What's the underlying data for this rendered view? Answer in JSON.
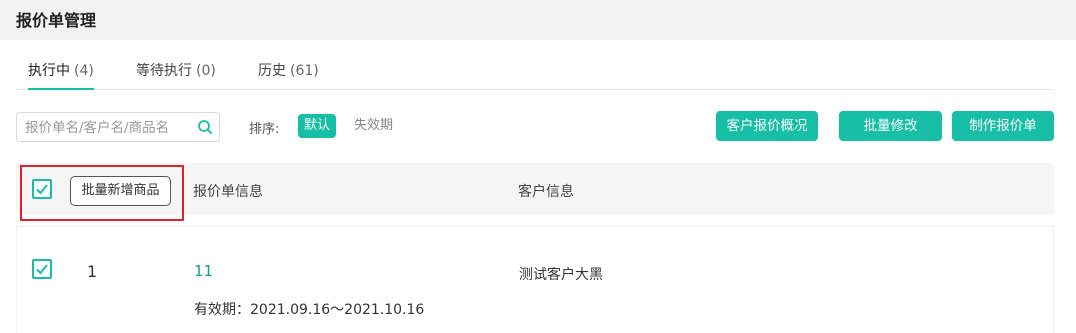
{
  "page": {
    "title": "报价单管理"
  },
  "tabs": [
    {
      "label": "执行中",
      "count": "(4)"
    },
    {
      "label": "等待执行",
      "count": "(0)"
    },
    {
      "label": "历史",
      "count": "(61)"
    }
  ],
  "search": {
    "placeholder": "报价单名/客户名/商品名"
  },
  "sort": {
    "label": "排序:",
    "options": [
      "默认",
      "失效期"
    ]
  },
  "actions": {
    "customer_overview": "客户报价概况",
    "batch_edit": "批量修改",
    "create_quote": "制作报价单"
  },
  "table": {
    "bulk_add_label": "批量新增商品",
    "headers": [
      "报价单信息",
      "客户信息"
    ],
    "rows": [
      {
        "index": "1",
        "quote_name": "11",
        "validity": "有效期：2021.09.16～2021.10.16",
        "customer": "测试客户大黑"
      }
    ]
  },
  "colors": {
    "accent": "#16bfa5",
    "highlight": "#d9262e"
  }
}
